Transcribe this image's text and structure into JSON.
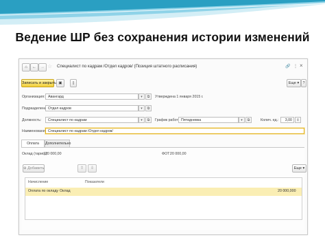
{
  "slide": {
    "title": "Ведение ШР без сохранения истории изменений",
    "colors": {
      "swoosh_dark": "#2a9fc2",
      "swoosh_light": "#8fd3e8",
      "swoosh_pale": "#d3eef6"
    }
  },
  "window": {
    "form_title": "Специалист по кадрам /Отдел кадров/ (Позиция штатного расписания)",
    "nav": {
      "home_icon": "home-icon",
      "back_icon": "arrow-left-icon",
      "forward_icon": "arrow-right-icon",
      "star_icon": "star-icon"
    },
    "controls": {
      "link": "🔗",
      "more": "⋮",
      "close": "×"
    }
  },
  "toolbar": {
    "save_close_label": "Записать и закрыть",
    "save_icon": "save-icon",
    "doc_icon": "document-icon",
    "more_label": "Еще ▾",
    "help_label": "?",
    "accent": "#f2cf38"
  },
  "form": {
    "org_label": "Организация:",
    "org_value": "Авангард",
    "approved_text": "Утверждена 1 января 2015 г.",
    "dept_label": "Подразделение:",
    "dept_value": "Отдел кадров",
    "position_label": "Должность:",
    "position_value": "Специалист по кадрам",
    "schedule_label": "График работы:",
    "schedule_value": "Пятидневка",
    "units_label": "Колич. ед.:",
    "units_value": "3,00",
    "name_label": "Наименование:",
    "name_value": "Специалист по кадрам /Отдел кадров/"
  },
  "tabs": [
    {
      "label": "Оплата труда"
    },
    {
      "label": "Дополнительно"
    }
  ],
  "pay": {
    "salary_label": "Оклад (тариф):",
    "salary_value": "20 000,00",
    "fot_label": "ФОТ:",
    "fot_value": "20 000,00",
    "add_label": "Добавить",
    "more_label": "Еще ▾"
  },
  "table": {
    "columns": [
      "Начисление",
      "Показатели"
    ],
    "rows": [
      {
        "accrual": "Оплата по окладу",
        "indicator": "Оклад",
        "amount": "20 000,000"
      }
    ]
  }
}
